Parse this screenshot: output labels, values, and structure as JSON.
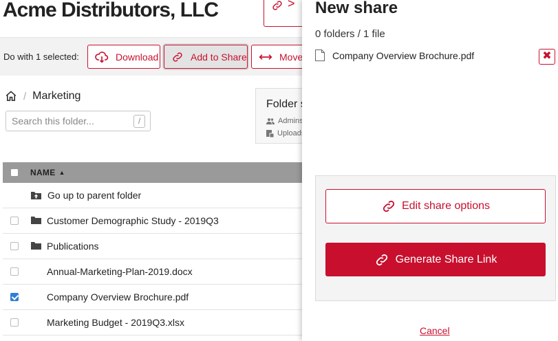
{
  "company": {
    "title": "Acme Distributors, LLC"
  },
  "actionbar": {
    "label": "Do with 1 selected:",
    "download_label": "Download",
    "add_to_share_label": "Add to Share",
    "move_label": "Move"
  },
  "breadcrumb": {
    "folder": "Marketing"
  },
  "search": {
    "placeholder": "Search this folder...",
    "shortcut": "/"
  },
  "folder_info": {
    "title": "Folder s",
    "row1": "Admins",
    "row2": "Uploads"
  },
  "table": {
    "header_name": "NAME",
    "sort_arrow": "▲",
    "rows": [
      {
        "name": "Go up to parent folder",
        "kind": "up"
      },
      {
        "name": "Customer Demographic Study - 2019Q3",
        "kind": "folder",
        "checked": false
      },
      {
        "name": "Publications",
        "kind": "folder",
        "checked": false
      },
      {
        "name": "Annual-Marketing-Plan-2019.docx",
        "kind": "file",
        "checked": false
      },
      {
        "name": "Company Overview Brochure.pdf",
        "kind": "file",
        "checked": true
      },
      {
        "name": "Marketing Budget - 2019Q3.xlsx",
        "kind": "file",
        "checked": false
      }
    ]
  },
  "share_panel": {
    "title": "New share",
    "counts": "0 folders / 1 file",
    "selected_file": "Company Overview Brochure.pdf",
    "remove_symbol": "✖",
    "edit_options_label": "Edit share options",
    "generate_link_label": "Generate Share Link",
    "cancel_label": "Cancel"
  },
  "colors": {
    "accent": "#c8102e",
    "checkbox_checked": "#2f7fd6",
    "table_header": "#9a9a9a"
  }
}
